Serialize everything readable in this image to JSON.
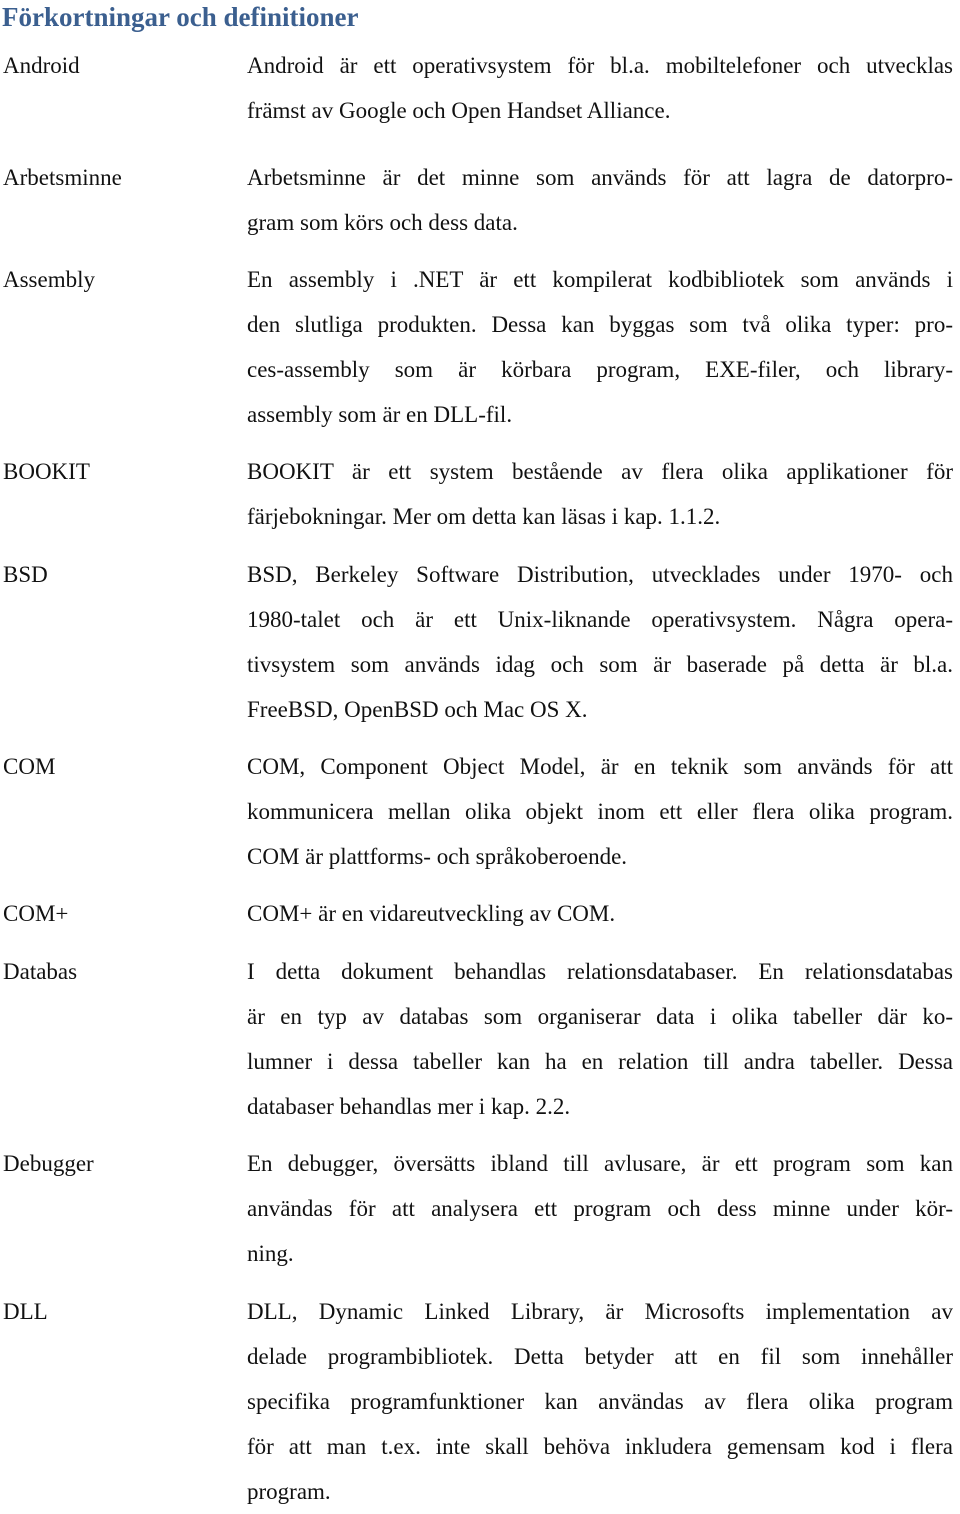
{
  "title": "Förkortningar och definitioner",
  "entries": [
    {
      "term": "Android",
      "lines": [
        "Android är ett operativsystem för bl.a. mobiltelefoner och utvecklas",
        "främst av Google och Open Handset Alliance."
      ]
    },
    {
      "term": "Arbetsminne",
      "lines": [
        "Arbetsminne är det minne som används för att lagra de datorpro-",
        "gram som körs och dess data."
      ]
    },
    {
      "term": "Assembly",
      "lines": [
        "En assembly i .NET är ett kompilerat kodbibliotek som används i",
        "den slutliga produkten. Dessa kan byggas som två olika typer: pro-",
        "ces-assembly som är körbara program, EXE-filer, och library-",
        "assembly som är en DLL-fil."
      ]
    },
    {
      "term": "BOOKIT",
      "lines": [
        "BOOKIT är ett system bestående av flera olika applikationer för",
        "färjebokningar. Mer om detta kan läsas i kap. 1.1.2."
      ]
    },
    {
      "term": "BSD",
      "lines": [
        "BSD, Berkeley Software Distribution, utvecklades under 1970- och",
        "1980-talet och är ett Unix-liknande operativsystem. Några opera-",
        "tivsystem som används idag och som är baserade på detta är bl.a.",
        "FreeBSD, OpenBSD och Mac OS X."
      ]
    },
    {
      "term": "COM",
      "lines": [
        "COM, Component Object Model, är en teknik som används för att",
        "kommunicera mellan olika objekt inom ett eller flera olika program.",
        "COM är plattforms- och språkoberoende."
      ]
    },
    {
      "term": "COM+",
      "lines": [
        "COM+ är en vidareutveckling av COM."
      ]
    },
    {
      "term": "Databas",
      "lines": [
        "I detta dokument behandlas relationsdatabaser. En relationsdatabas",
        "är en typ av databas som organiserar data i olika tabeller där ko-",
        "lumner i dessa tabeller kan ha en relation till andra tabeller. Dessa",
        "databaser behandlas mer i kap. 2.2."
      ]
    },
    {
      "term": "Debugger",
      "lines": [
        "En debugger, översätts ibland till avlusare, är ett program som kan",
        "användas för att analysera ett program och dess minne under kör-",
        "ning."
      ]
    },
    {
      "term": "DLL",
      "lines": [
        "DLL, Dynamic Linked Library, är Microsofts implementation av",
        "delade programbibliotek. Detta betyder att en fil som innehåller",
        "specifika programfunktioner kan användas av flera olika program",
        "för att man t.ex. inte skall behöva inkludera gemensam kod i flera",
        "program."
      ]
    }
  ]
}
